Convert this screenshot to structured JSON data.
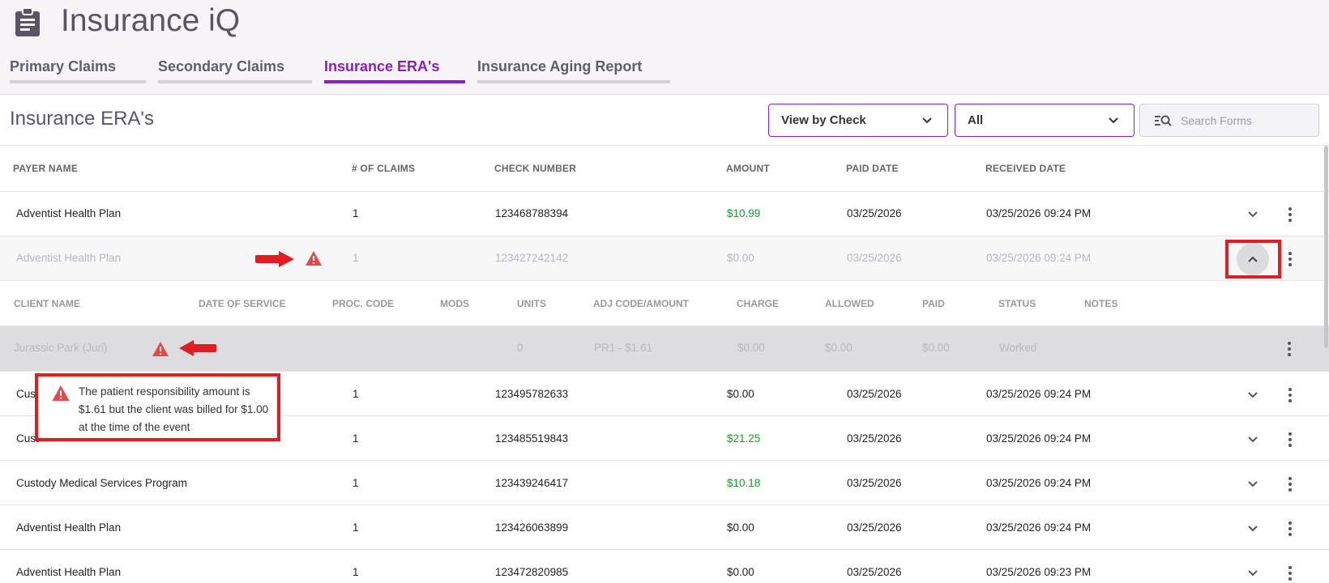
{
  "app": {
    "title": "Insurance iQ",
    "icon": "clipboard-icon"
  },
  "tabs": [
    {
      "label": "Primary Claims",
      "active": false
    },
    {
      "label": "Secondary Claims",
      "active": false
    },
    {
      "label": "Insurance ERA's",
      "active": true
    },
    {
      "label": "Insurance Aging Report",
      "active": false
    }
  ],
  "page": {
    "title": "Insurance ERA's"
  },
  "filters": {
    "view_select": "View by Check",
    "status_select": "All",
    "search_placeholder": "Search Forms"
  },
  "table": {
    "headers": [
      "PAYER NAME",
      "# OF CLAIMS",
      "CHECK NUMBER",
      "AMOUNT",
      "PAID DATE",
      "RECEIVED DATE"
    ],
    "rows": [
      {
        "payer": "Adventist Health Plan",
        "claims": "1",
        "check": "123468788394",
        "amount": "$10.99",
        "paid": "03/25/2026",
        "received": "03/25/2026 09:24 PM"
      },
      {
        "payer": "Adventist Health Plan",
        "claims": "1",
        "check": "123427242142",
        "amount": "$0.00",
        "paid": "03/25/2026",
        "received": "03/25/2026 09:24 PM"
      },
      {
        "payer": "Cust",
        "claims": "1",
        "check": "123495782633",
        "amount": "$0.00",
        "paid": "03/25/2026",
        "received": "03/25/2026 09:24 PM"
      },
      {
        "payer": "Cust",
        "claims": "1",
        "check": "123485519843",
        "amount": "$21.25",
        "paid": "03/25/2026",
        "received": "03/25/2026 09:24 PM"
      },
      {
        "payer": "Custody Medical Services Program",
        "claims": "1",
        "check": "123439246417",
        "amount": "$10.18",
        "paid": "03/25/2026",
        "received": "03/25/2026 09:24 PM"
      },
      {
        "payer": "Adventist Health Plan",
        "claims": "1",
        "check": "123426063899",
        "amount": "$0.00",
        "paid": "03/25/2026",
        "received": "03/25/2026 09:24 PM"
      },
      {
        "payer": "Adventist Health Plan",
        "claims": "1",
        "check": "123472820985",
        "amount": "$0.00",
        "paid": "03/25/2026",
        "received": "03/25/2026 09:23 PM"
      }
    ]
  },
  "subtable": {
    "headers": [
      "CLIENT NAME",
      "DATE OF SERVICE",
      "PROC. CODE",
      "MODS",
      "UNITS",
      "ADJ CODE/AMOUNT",
      "CHARGE",
      "ALLOWED",
      "PAID",
      "STATUS",
      "NOTES"
    ],
    "row": {
      "client": "Jurassic Park (Juri)",
      "units": "0",
      "adj": "PR1 - $1.61",
      "charge": "$0.00",
      "allowed": "$0.00",
      "paid": "$0.00",
      "status": "Worked"
    }
  },
  "tooltip": {
    "text": "The patient responsibility amount is $1.61 but the client was billed for $1.00 at the time of the event"
  },
  "colors": {
    "accent": "#8a1fbf",
    "positive": "#1e9b2e",
    "warning": "#e8474a",
    "annotation": "#e11d22"
  }
}
